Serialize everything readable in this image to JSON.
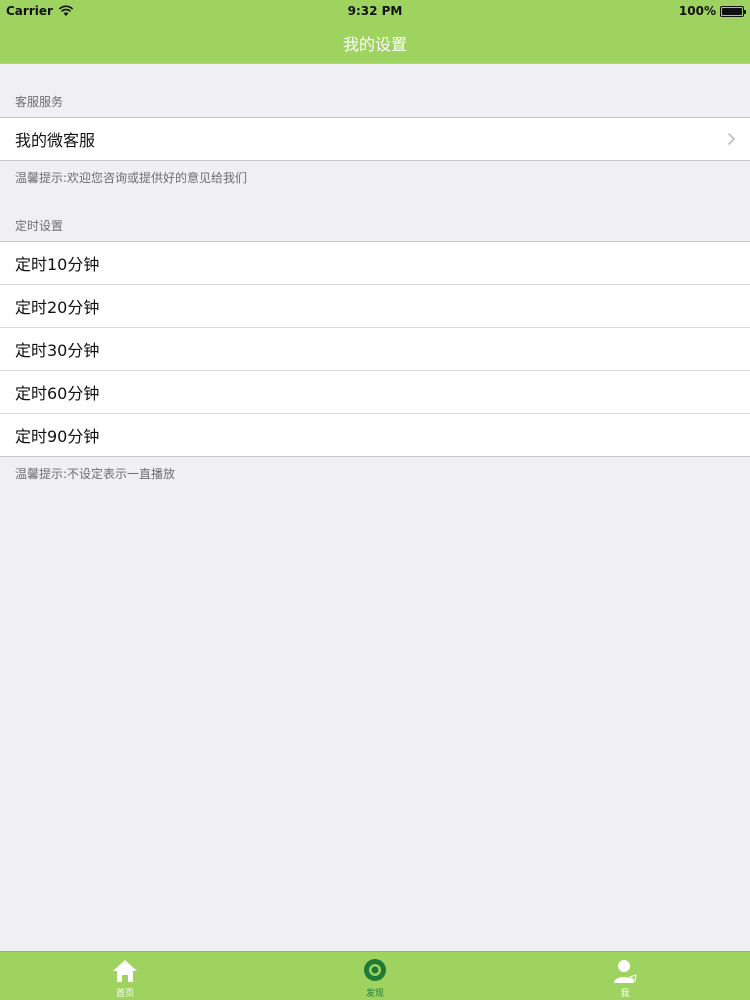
{
  "status_bar": {
    "carrier": "Carrier",
    "time": "9:32 PM",
    "battery": "100%"
  },
  "nav": {
    "title": "我的设置"
  },
  "sections": [
    {
      "header": "客服服务",
      "items": [
        {
          "label": "我的微客服",
          "has_chevron": true
        }
      ],
      "footer": "温馨提示:欢迎您咨询或提供好的意见给我们"
    },
    {
      "header": "定时设置",
      "items": [
        {
          "label": "定时10分钟"
        },
        {
          "label": "定时20分钟"
        },
        {
          "label": "定时30分钟"
        },
        {
          "label": "定时60分钟"
        },
        {
          "label": "定时90分钟"
        }
      ],
      "footer": "温馨提示:不设定表示一直播放"
    }
  ],
  "tabbar": {
    "tabs": [
      {
        "label": "首页",
        "icon": "home-icon",
        "active": false
      },
      {
        "label": "发现",
        "icon": "eye-icon",
        "active": true
      },
      {
        "label": "我",
        "icon": "user-icon",
        "active": false
      }
    ]
  },
  "colors": {
    "bar_green": "#9fd35f",
    "background": "#efeff4",
    "active_tab": "#1e7a35"
  }
}
